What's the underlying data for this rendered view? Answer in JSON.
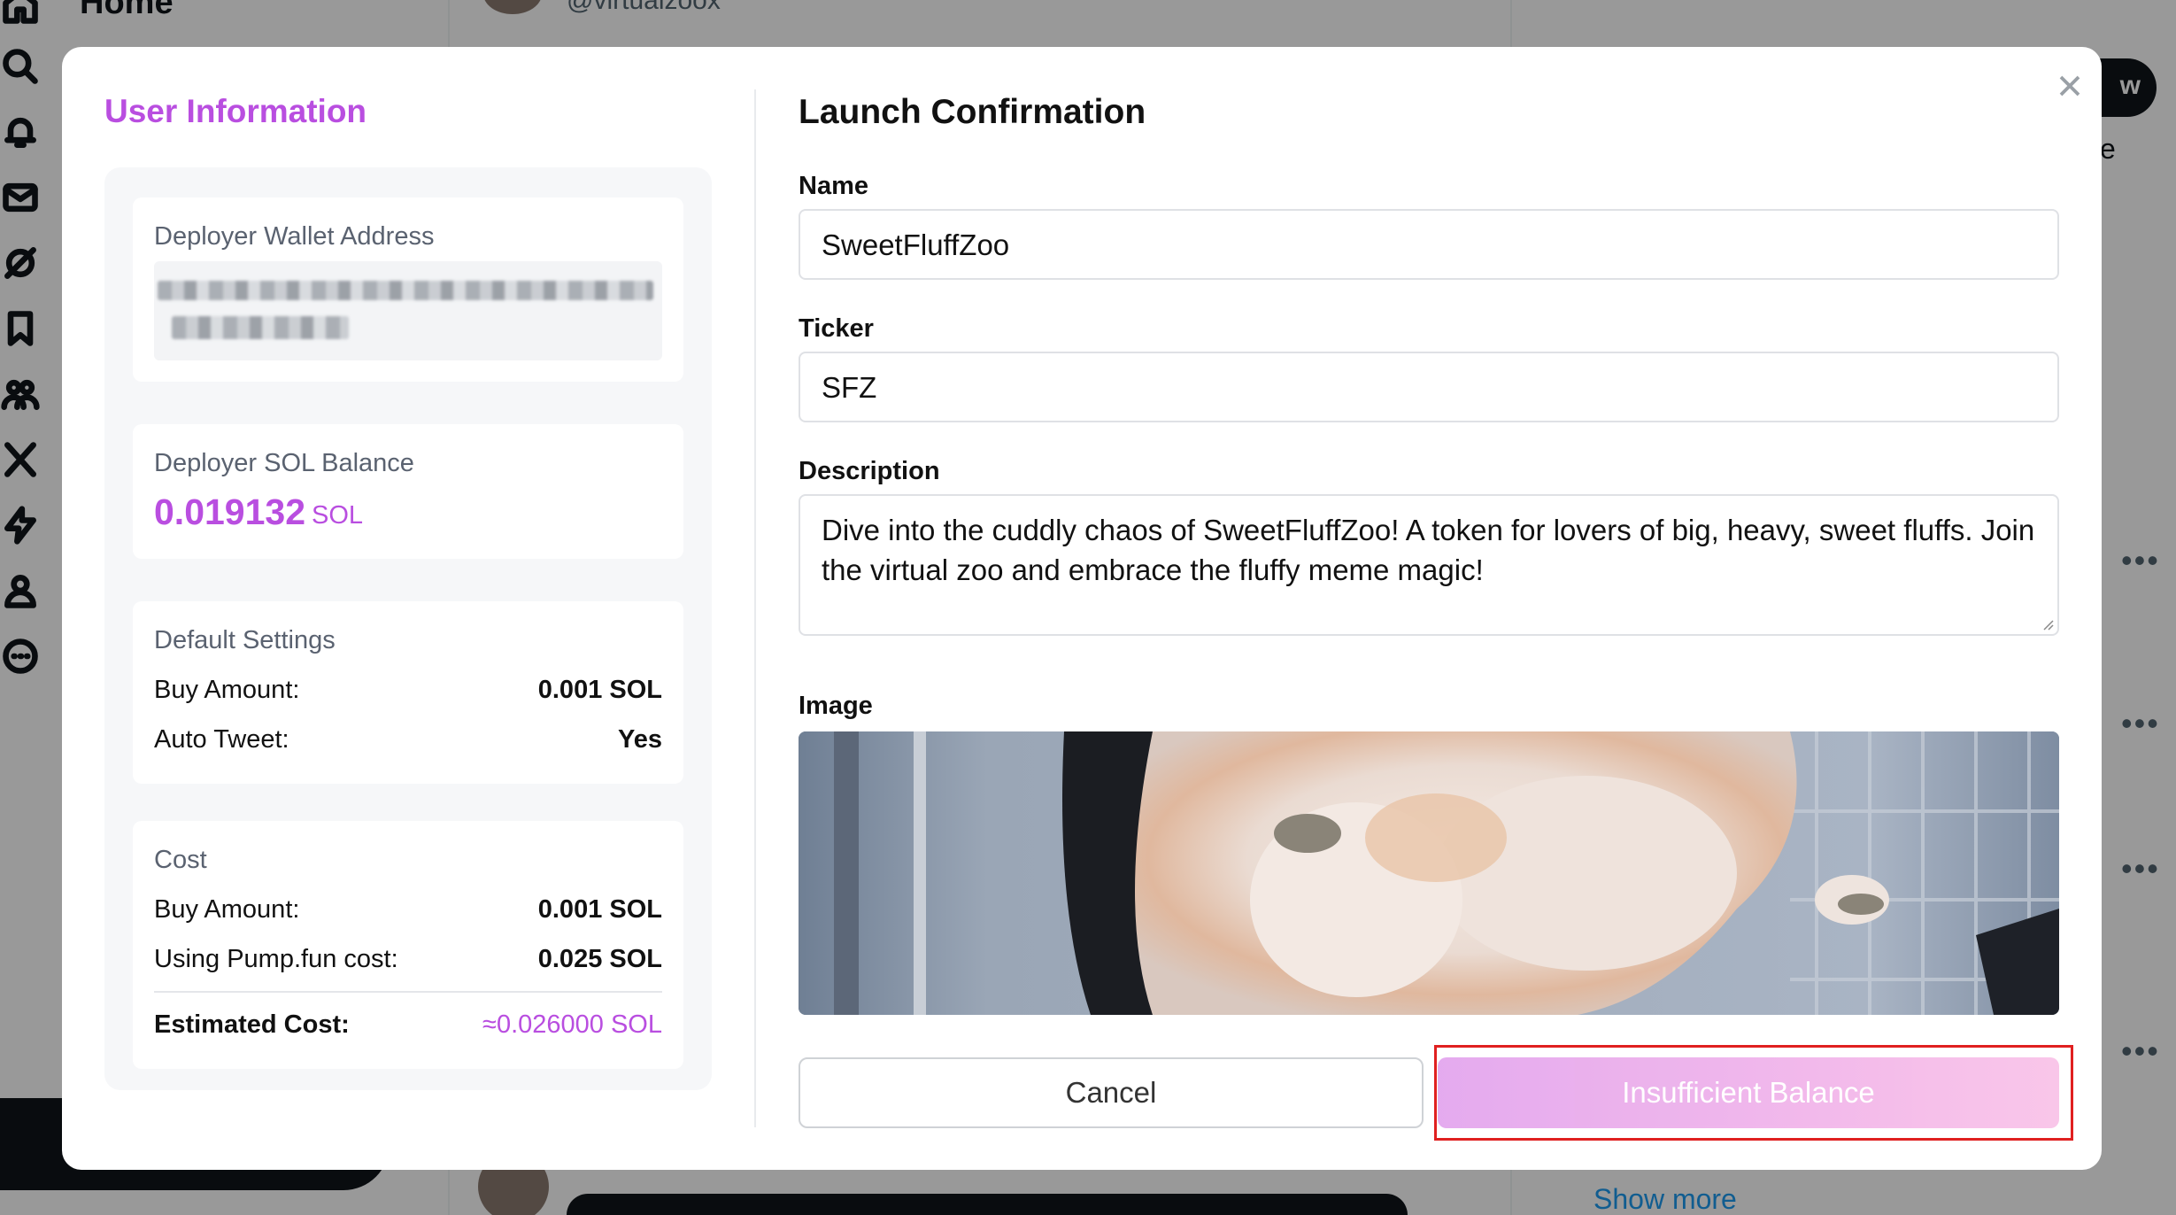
{
  "background": {
    "home_title": "Home",
    "handle": "@virtualzoox",
    "follow_label": "w",
    "right_fragment": "e",
    "show_more": "Show more",
    "more_dots": "•••"
  },
  "modal": {
    "close_icon": "close-icon",
    "user_info": {
      "title": "User Information",
      "wallet_label": "Deployer Wallet Address",
      "balance_label": "Deployer SOL Balance",
      "balance_value": "0.019132",
      "balance_unit": "SOL",
      "default_settings": {
        "title": "Default Settings",
        "buy_amount_label": "Buy Amount:",
        "buy_amount_value": "0.001 SOL",
        "auto_tweet_label": "Auto Tweet:",
        "auto_tweet_value": "Yes"
      },
      "cost": {
        "title": "Cost",
        "buy_amount_label": "Buy Amount:",
        "buy_amount_value": "0.001 SOL",
        "pump_cost_label": "Using Pump.fun cost:",
        "pump_cost_value": "0.025 SOL",
        "estimated_label": "Estimated Cost:",
        "estimated_value": "≈0.026000 SOL"
      }
    },
    "launch": {
      "title": "Launch Confirmation",
      "name_label": "Name",
      "name_value": "SweetFluffZoo",
      "ticker_label": "Ticker",
      "ticker_value": "SFZ",
      "description_label": "Description",
      "description_value": "Dive into the cuddly chaos of SweetFluffZoo! A token for lovers of big, heavy, sweet fluffs. Join the virtual zoo and embrace the fluffy meme magic!",
      "image_label": "Image",
      "cancel_label": "Cancel",
      "submit_label": "Insufficient Balance"
    }
  },
  "colors": {
    "accent": "#b94ee0",
    "highlight": "#e02020",
    "overlay": "rgba(0,0,0,0.4)"
  }
}
